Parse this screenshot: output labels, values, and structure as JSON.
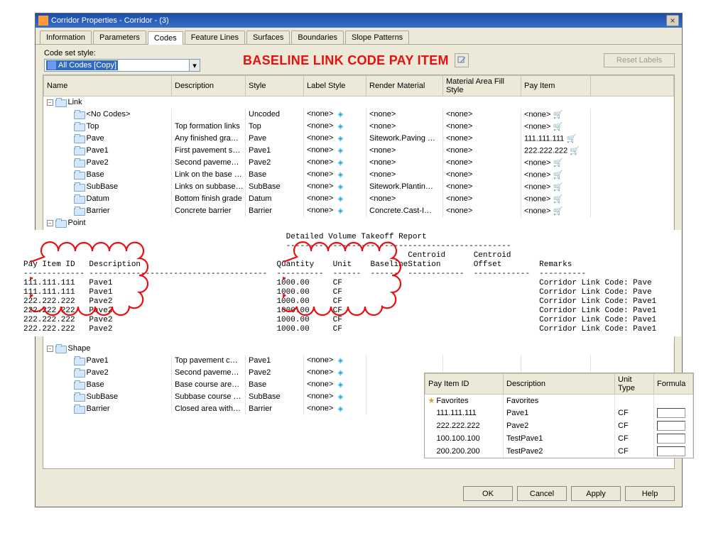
{
  "window": {
    "title": "Corridor Properties - Corridor - (3)"
  },
  "tabs": [
    {
      "label": "Information"
    },
    {
      "label": "Parameters"
    },
    {
      "label": "Codes"
    },
    {
      "label": "Feature Lines"
    },
    {
      "label": "Surfaces"
    },
    {
      "label": "Boundaries"
    },
    {
      "label": "Slope Patterns"
    }
  ],
  "activeTab": 2,
  "codeSet": {
    "label": "Code set style:",
    "value": "All Codes [Copy]"
  },
  "overlayTitle": "BASELINE LINK CODE PAY ITEM",
  "resetButton": "Reset Labels",
  "columns": {
    "name": "Name",
    "description": "Description",
    "style": "Style",
    "labelStyle": "Label Style",
    "renderMaterial": "Render Material",
    "materialFill": "Material Area Fill Style",
    "payItem": "Pay Item"
  },
  "linkGroup": "Link",
  "pointGroup": "Point",
  "shapeGroup": "Shape",
  "linkRows": [
    {
      "name": "<No Codes>",
      "desc": "",
      "style": "Uncoded",
      "label": "<none>",
      "render": "<none>",
      "fill": "<none>",
      "pay": "<none>"
    },
    {
      "name": "Top",
      "desc": "Top formation links",
      "style": "Top",
      "label": "<none>",
      "render": "<none>",
      "fill": "<none>",
      "pay": "<none>"
    },
    {
      "name": "Pave",
      "desc": "Any finished gra…",
      "style": "Pave",
      "label": "<none>",
      "render": "Sitework.Paving …",
      "fill": "<none>",
      "pay": "111.111.111"
    },
    {
      "name": "Pave1",
      "desc": "First pavement s…",
      "style": "Pave1",
      "label": "<none>",
      "render": "<none>",
      "fill": "<none>",
      "pay": "222.222.222"
    },
    {
      "name": "Pave2",
      "desc": "Second paveme…",
      "style": "Pave2",
      "label": "<none>",
      "render": "<none>",
      "fill": "<none>",
      "pay": "<none>"
    },
    {
      "name": "Base",
      "desc": "Link on the base …",
      "style": "Base",
      "label": "<none>",
      "render": "<none>",
      "fill": "<none>",
      "pay": "<none>"
    },
    {
      "name": "SubBase",
      "desc": "Links on subbase…",
      "style": "SubBase",
      "label": "<none>",
      "render": "Sitework.Plantin…",
      "fill": "<none>",
      "pay": "<none>"
    },
    {
      "name": "Datum",
      "desc": "Bottom finish grade",
      "style": "Datum",
      "label": "<none>",
      "render": "<none>",
      "fill": "<none>",
      "pay": "<none>"
    },
    {
      "name": "Barrier",
      "desc": "Concrete barrier",
      "style": "Barrier",
      "label": "<none>",
      "render": "Concrete.Cast-I…",
      "fill": "<none>",
      "pay": "<none>"
    }
  ],
  "shapeRows": [
    {
      "name": "Pave1",
      "desc": "Top pavement c…",
      "style": "Pave1",
      "label": "<none>"
    },
    {
      "name": "Pave2",
      "desc": "Second paveme…",
      "style": "Pave2",
      "label": "<none>"
    },
    {
      "name": "Base",
      "desc": "Base course are…",
      "style": "Base",
      "label": "<none>"
    },
    {
      "name": "SubBase",
      "desc": "Subbase course …",
      "style": "SubBase",
      "label": "<none>"
    },
    {
      "name": "Barrier",
      "desc": "Closed area with…",
      "style": "Barrier",
      "label": "<none>"
    }
  ],
  "report": {
    "title": "Detailed Volume Takeoff Report",
    "headers": {
      "payItemId": "Pay Item ID",
      "description": "Description",
      "quantity": "Quantity",
      "unit": "Unit",
      "baseline": "Baseline",
      "centroidStation": "Centroid\nStation",
      "centroidOffset": "Centroid\nOffset",
      "remarks": "Remarks"
    },
    "rows": [
      {
        "id": "111.111.111",
        "desc": "Pave1",
        "qty": "1000.00",
        "unit": "CF",
        "remarks": "Corridor Link Code: Pave"
      },
      {
        "id": "111.111.111",
        "desc": "Pave1",
        "qty": "1000.00",
        "unit": "CF",
        "remarks": "Corridor Link Code: Pave"
      },
      {
        "id": "222.222.222",
        "desc": "Pave2",
        "qty": "1000.00",
        "unit": "CF",
        "remarks": "Corridor Link Code: Pave1"
      },
      {
        "id": "222.222.222",
        "desc": "Pave2",
        "qty": "1000.00",
        "unit": "CF",
        "remarks": "Corridor Link Code: Pave1"
      },
      {
        "id": "222.222.222",
        "desc": "Pave2",
        "qty": "1000.00",
        "unit": "CF",
        "remarks": "Corridor Link Code: Pave1"
      },
      {
        "id": "222.222.222",
        "desc": "Pave2",
        "qty": "1000.00",
        "unit": "CF",
        "remarks": "Corridor Link Code: Pave1"
      }
    ]
  },
  "payItemPanel": {
    "cols": {
      "id": "Pay Item ID",
      "desc": "Description",
      "unit": "Unit Type",
      "formula": "Formula"
    },
    "favorites": "Favorites",
    "rows": [
      {
        "id": "111.111.111",
        "desc": "Pave1",
        "unit": "CF"
      },
      {
        "id": "222.222.222",
        "desc": "Pave2",
        "unit": "CF"
      },
      {
        "id": "100.100.100",
        "desc": "TestPave1",
        "unit": "CF"
      },
      {
        "id": "200.200.200",
        "desc": "TestPave2",
        "unit": "CF"
      }
    ]
  },
  "buttons": {
    "ok": "OK",
    "cancel": "Cancel",
    "apply": "Apply",
    "help": "Help"
  }
}
